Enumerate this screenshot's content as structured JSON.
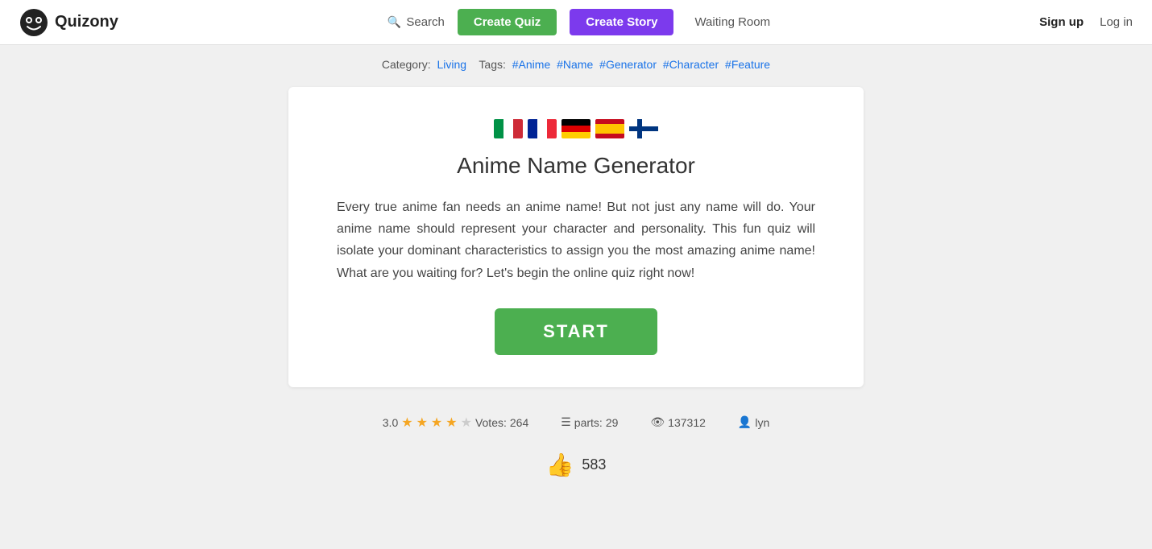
{
  "header": {
    "logo_text": "Quizony",
    "search_label": "Search",
    "create_quiz_label": "Create Quiz",
    "create_story_label": "Create Story",
    "waiting_room_label": "Waiting Room",
    "signup_label": "Sign up",
    "login_label": "Log in"
  },
  "tags": {
    "category_label": "Category:",
    "category_value": "Living",
    "tags_label": "Tags:",
    "tags": [
      "#Anime",
      "#Name",
      "#Generator",
      "#Character",
      "#Feature"
    ]
  },
  "quiz": {
    "title": "Anime Name Generator",
    "description": "Every true anime fan needs an anime name! But not just any name will do. Your anime name should represent your character and personality. This fun quiz will isolate your dominant characteristics to assign you the most amazing anime name! What are you waiting for? Let's begin the online quiz right now!",
    "start_label": "START",
    "flags": [
      "Italy",
      "France",
      "Germany",
      "Spain",
      "Finland"
    ]
  },
  "stats": {
    "rating": "3.0",
    "votes_label": "Votes:",
    "votes_count": "264",
    "parts_label": "parts:",
    "parts_count": "29",
    "views_count": "137312",
    "author": "lyn"
  },
  "likes": {
    "count": "583"
  }
}
